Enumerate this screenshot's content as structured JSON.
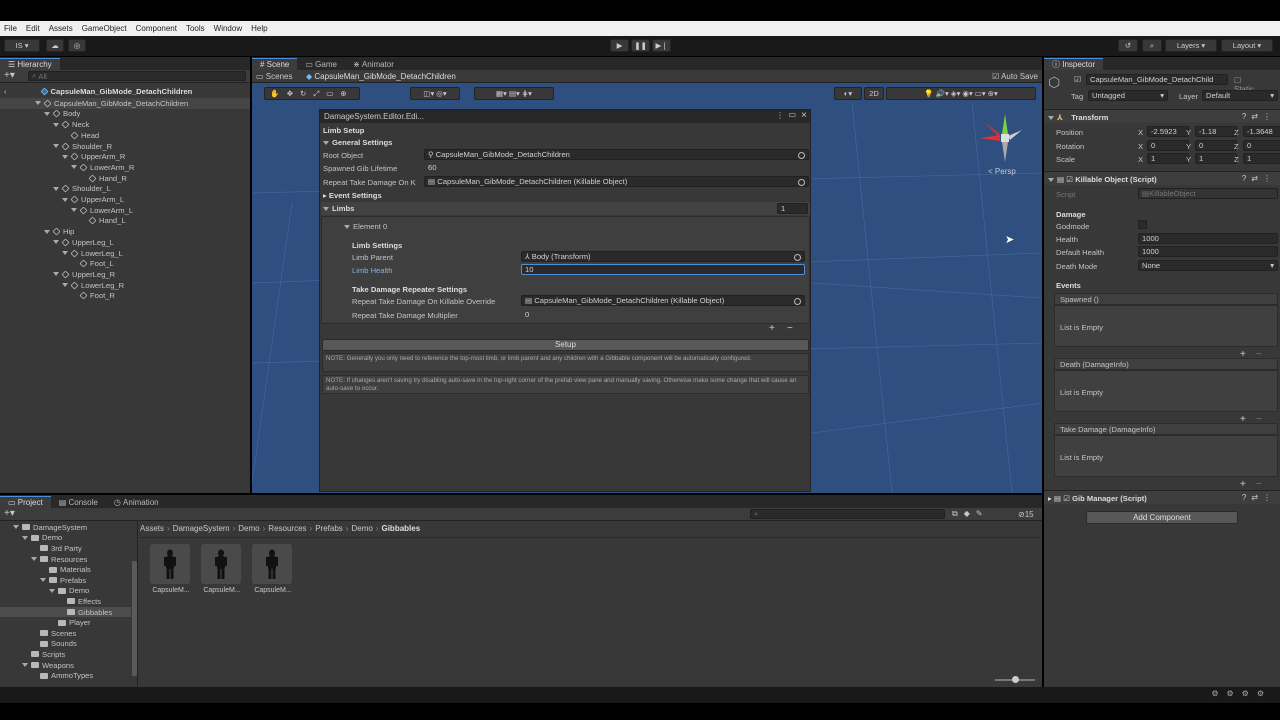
{
  "menu": [
    "File",
    "Edit",
    "Assets",
    "GameObject",
    "Component",
    "Tools",
    "Window",
    "Help"
  ],
  "toolbar": {
    "account": "IS",
    "layers": "Layers",
    "layout": "Layout"
  },
  "hierarchy": {
    "tab": "Hierarchy",
    "search_placeholder": "All",
    "root": "CapsuleMan_GibMode_DetachChildren",
    "items": [
      {
        "label": "CapsuleMan_GibMode_DetachChildren",
        "depth": 1
      },
      {
        "label": "Body",
        "depth": 2
      },
      {
        "label": "Neck",
        "depth": 3
      },
      {
        "label": "Head",
        "depth": 4
      },
      {
        "label": "Shoulder_R",
        "depth": 3
      },
      {
        "label": "UpperArm_R",
        "depth": 4
      },
      {
        "label": "LowerArm_R",
        "depth": 5
      },
      {
        "label": "Hand_R",
        "depth": 6
      },
      {
        "label": "Shoulder_L",
        "depth": 3
      },
      {
        "label": "UpperArm_L",
        "depth": 4
      },
      {
        "label": "LowerArm_L",
        "depth": 5
      },
      {
        "label": "Hand_L",
        "depth": 6
      },
      {
        "label": "Hip",
        "depth": 2
      },
      {
        "label": "UpperLeg_L",
        "depth": 3
      },
      {
        "label": "LowerLeg_L",
        "depth": 4
      },
      {
        "label": "Foot_L",
        "depth": 5
      },
      {
        "label": "UpperLeg_R",
        "depth": 3
      },
      {
        "label": "LowerLeg_R",
        "depth": 4
      },
      {
        "label": "Foot_R",
        "depth": 5
      }
    ]
  },
  "scene": {
    "tabs": [
      "Scene",
      "Game",
      "Animator"
    ],
    "breadcrumb_scenes": "Scenes",
    "breadcrumb_prefab": "CapsuleMan_GibMode_DetachChildren",
    "auto_save": "Auto Save",
    "mode_2d": "2D",
    "persp": "Persp"
  },
  "editor_window": {
    "title": "DamageSystem.Editor.Edi...",
    "header": "Limb Setup",
    "general_settings": "General Settings",
    "root_object_label": "Root Object",
    "root_object_value": "CapsuleMan_GibMode_DetachChildren",
    "gib_lifetime_label": "Spawned Gib Lifetime",
    "gib_lifetime_value": "60",
    "repeat_label": "Repeat Take Damage On K",
    "repeat_value": "CapsuleMan_GibMode_DetachChildren (Killable Object)",
    "event_settings": "Event Settings",
    "limbs": "Limbs",
    "limbs_count": "1",
    "element0": "Element 0",
    "limb_settings": "Limb Settings",
    "limb_parent_label": "Limb Parent",
    "limb_parent_value": "Body (Transform)",
    "limb_health_label": "Limb Health",
    "limb_health_value": "10",
    "repeater_settings": "Take Damage Repeater Settings",
    "override_label": "Repeat Take Damage On Killable Override",
    "override_value": "CapsuleMan_GibMode_DetachChildren (Killable Object)",
    "multiplier_label": "Repeat Take Damage Multiplier",
    "multiplier_value": "0",
    "setup_button": "Setup",
    "note1": "NOTE: Generally you only need to reference the top-most limb, or limb parent and any children with a Gibbable component will be automatically configured.",
    "note2": "NOTE: If changes aren't saving try disabling auto-save in the top-right corner of the prefab view pane and manually saving. Otherwise make some change that will cause an auto-save to occur."
  },
  "project": {
    "tabs": [
      "Project",
      "Console",
      "Animation"
    ],
    "tree": [
      {
        "label": "DamageSystem",
        "depth": 1
      },
      {
        "label": "Demo",
        "depth": 2
      },
      {
        "label": "3rd Party",
        "depth": 3
      },
      {
        "label": "Resources",
        "depth": 3
      },
      {
        "label": "Materials",
        "depth": 4
      },
      {
        "label": "Prefabs",
        "depth": 4
      },
      {
        "label": "Demo",
        "depth": 5
      },
      {
        "label": "Effects",
        "depth": 6
      },
      {
        "label": "Gibbables",
        "depth": 6
      },
      {
        "label": "Player",
        "depth": 5
      },
      {
        "label": "Scenes",
        "depth": 3
      },
      {
        "label": "Sounds",
        "depth": 3
      },
      {
        "label": "Scripts",
        "depth": 2
      },
      {
        "label": "Weapons",
        "depth": 2
      },
      {
        "label": "AmmoTypes",
        "depth": 3
      }
    ],
    "breadcrumb": [
      "Assets",
      "DamageSystem",
      "Demo",
      "Resources",
      "Prefabs",
      "Demo",
      "Gibbables"
    ],
    "assets": [
      "CapsuleM...",
      "CapsuleM...",
      "CapsuleM..."
    ],
    "hidden_count": "15"
  },
  "inspector": {
    "tab": "Inspector",
    "object_name": "CapsuleMan_GibMode_DetachChild",
    "static": "Static",
    "tag_label": "Tag",
    "tag_value": "Untagged",
    "layer_label": "Layer",
    "layer_value": "Default",
    "transform": "Transform",
    "position_label": "Position",
    "pos_x": "-2.5923",
    "pos_y": "-1.18",
    "pos_z": "-1.3648",
    "rotation_label": "Rotation",
    "rot_x": "0",
    "rot_y": "0",
    "rot_z": "0",
    "scale_label": "Scale",
    "scale_x": "1",
    "scale_y": "1",
    "scale_z": "1",
    "killable": "Killable Object (Script)",
    "script_label": "Script",
    "script_value": "KillableObject",
    "damage": "Damage",
    "godmode": "Godmode",
    "health_label": "Health",
    "health_value": "1000",
    "default_health_label": "Default Health",
    "default_health_value": "1000",
    "death_mode_label": "Death Mode",
    "death_mode_value": "None",
    "events": "Events",
    "event1": "Spawned ()",
    "event2": "Death (DamageInfo)",
    "event3": "Take Damage (DamageInfo)",
    "list_empty": "List is Empty",
    "gib_manager": "Gib Manager (Script)",
    "add_component": "Add Component"
  }
}
